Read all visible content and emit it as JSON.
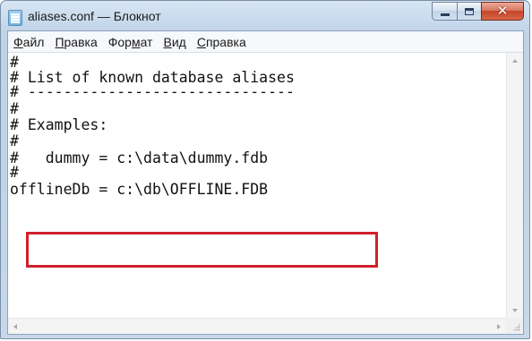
{
  "window": {
    "title": "aliases.conf — Блокнот",
    "close_glyph": "✕"
  },
  "menu": [
    {
      "prefix": "",
      "accel": "Ф",
      "rest": "айл"
    },
    {
      "prefix": "",
      "accel": "П",
      "rest": "равка"
    },
    {
      "prefix": "Фор",
      "accel": "м",
      "rest": "ат"
    },
    {
      "prefix": "",
      "accel": "В",
      "rest": "ид"
    },
    {
      "prefix": "",
      "accel": "С",
      "rest": "правка"
    }
  ],
  "editor": {
    "lines": [
      "#",
      "# List of known database aliases",
      "# ------------------------------",
      "#",
      "# Examples:",
      "#",
      "#   dummy = c:\\data\\dummy.fdb",
      "#",
      "offlineDb = c:\\db\\OFFLINE.FDB"
    ]
  },
  "colors": {
    "highlight": "#d0202a",
    "title_bg": "#c3d6ea",
    "close_button": "#c64427"
  },
  "icons": {
    "app": "notepad-icon",
    "minimize": "minimize-icon",
    "maximize": "maximize-icon",
    "close": "close-icon"
  }
}
